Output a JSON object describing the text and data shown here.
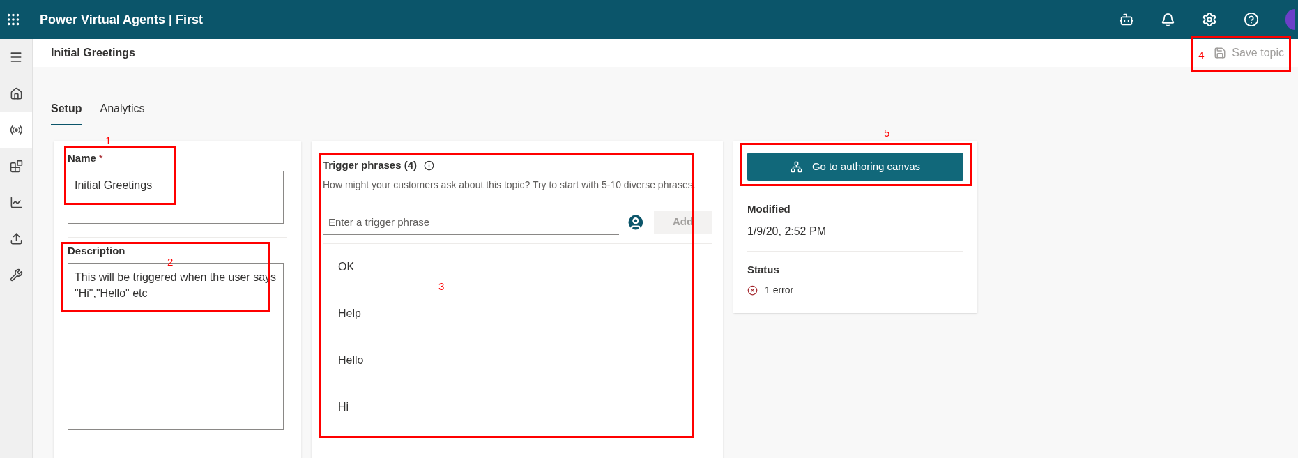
{
  "app_bar": {
    "title": "Power Virtual Agents | First"
  },
  "nav_rail": {
    "items": [
      {
        "selected": false
      },
      {
        "selected": true
      },
      {
        "selected": false
      },
      {
        "selected": false
      },
      {
        "selected": false
      },
      {
        "selected": false
      }
    ]
  },
  "header": {
    "title": "Initial Greetings",
    "save_button": {
      "label": "Save topic",
      "disabled": true,
      "marker": "4"
    }
  },
  "tabs": [
    {
      "label": "Setup",
      "selected": true
    },
    {
      "label": "Analytics",
      "selected": false
    }
  ],
  "details_card": {
    "name": {
      "label": "Name",
      "required_mark": "*",
      "value": "Initial Greetings",
      "marker": "1"
    },
    "description": {
      "label": "Description",
      "value": "This will be triggered when the user says \"Hi\",\"Hello\" etc",
      "marker": "2"
    }
  },
  "trigger_card": {
    "title": "Trigger phrases (4)",
    "hint": "How might your customers ask about this topic? Try to start with 5-10 diverse phrases.",
    "input": {
      "placeholder": "Enter a trigger phrase"
    },
    "add_button": {
      "label": "Add",
      "disabled": true
    },
    "marker": "3",
    "phrases": [
      "OK",
      "Help",
      "Hello",
      "Hi"
    ]
  },
  "status_card": {
    "canvas_button": {
      "label": "Go to authoring canvas",
      "marker": "5"
    },
    "modified": {
      "label": "Modified",
      "value": "1/9/20, 2:52 PM"
    },
    "status": {
      "label": "Status",
      "value": "1 error"
    }
  }
}
